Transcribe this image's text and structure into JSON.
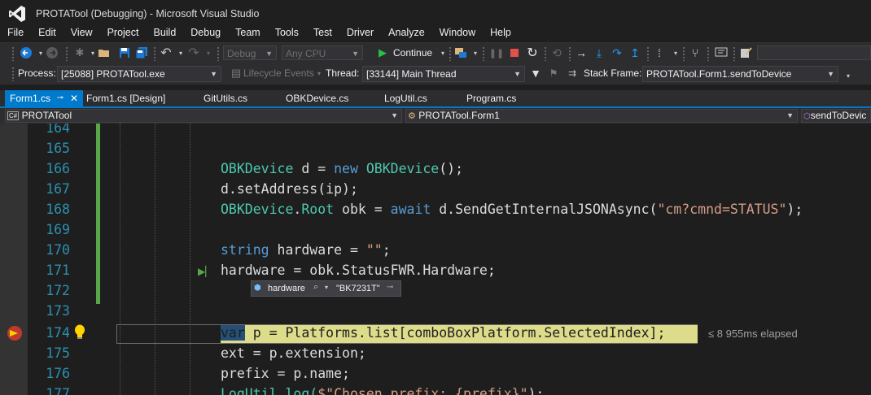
{
  "window": {
    "title": "PROTATool (Debugging) - Microsoft Visual Studio"
  },
  "menu": [
    "File",
    "Edit",
    "View",
    "Project",
    "Build",
    "Debug",
    "Team",
    "Tools",
    "Test",
    "Driver",
    "Analyze",
    "Window",
    "Help"
  ],
  "toolbar": {
    "config": "Debug",
    "platform": "Any CPU",
    "continue_label": "Continue"
  },
  "debug_location": {
    "process_label": "Process:",
    "process_value": "[25088] PROTATool.exe",
    "lifecycle_label": "Lifecycle Events",
    "thread_label": "Thread:",
    "thread_value": "[33144] Main Thread",
    "stackframe_label": "Stack Frame:",
    "stackframe_value": "PROTATool.Form1.sendToDevice"
  },
  "tabs": [
    "Form1.cs",
    "Form1.cs [Design]",
    "GitUtils.cs",
    "OBKDevice.cs",
    "LogUtil.cs",
    "Program.cs"
  ],
  "navbar": {
    "project": "PROTATool",
    "type": "PROTATool.Form1",
    "member": "sendToDevic"
  },
  "line_numbers": [
    "164",
    "165",
    "166",
    "167",
    "168",
    "169",
    "170",
    "171",
    "172",
    "173",
    "174",
    "175",
    "176",
    "177"
  ],
  "code": {
    "l166a": "OBKDevice",
    "l166b": " d = ",
    "l166c": "new",
    "l166d": " ",
    "l166e": "OBKDevice",
    "l166f": "();",
    "l167": "d.setAddress(ip);",
    "l168a": "OBKDevice",
    "l168b": ".",
    "l168c": "Root",
    "l168d": " obk = ",
    "l168e": "await",
    "l168f": " d.SendGetInternalJSONAsync(",
    "l168g": "\"cm?cmnd=STATUS\"",
    "l168h": ");",
    "l170a": "string",
    "l170b": " hardware = ",
    "l170c": "\"\"",
    "l170d": ";",
    "l171": "hardware = obk.StatusFWR.Hardware;",
    "l174a": "var",
    "l174b": " p = Platforms.list[comboBoxPlatform.SelectedIndex];",
    "l175": "ext = p.extension;",
    "l176": "prefix = p.name;",
    "l177a": "LogUtil.log(",
    "l177b": "$\"Chosen prefix: {prefix}\"",
    "l177c": ");"
  },
  "datatip": {
    "name": "hardware",
    "value": "\"BK7231T\""
  },
  "elapsed": "≤ 8 955ms elapsed"
}
